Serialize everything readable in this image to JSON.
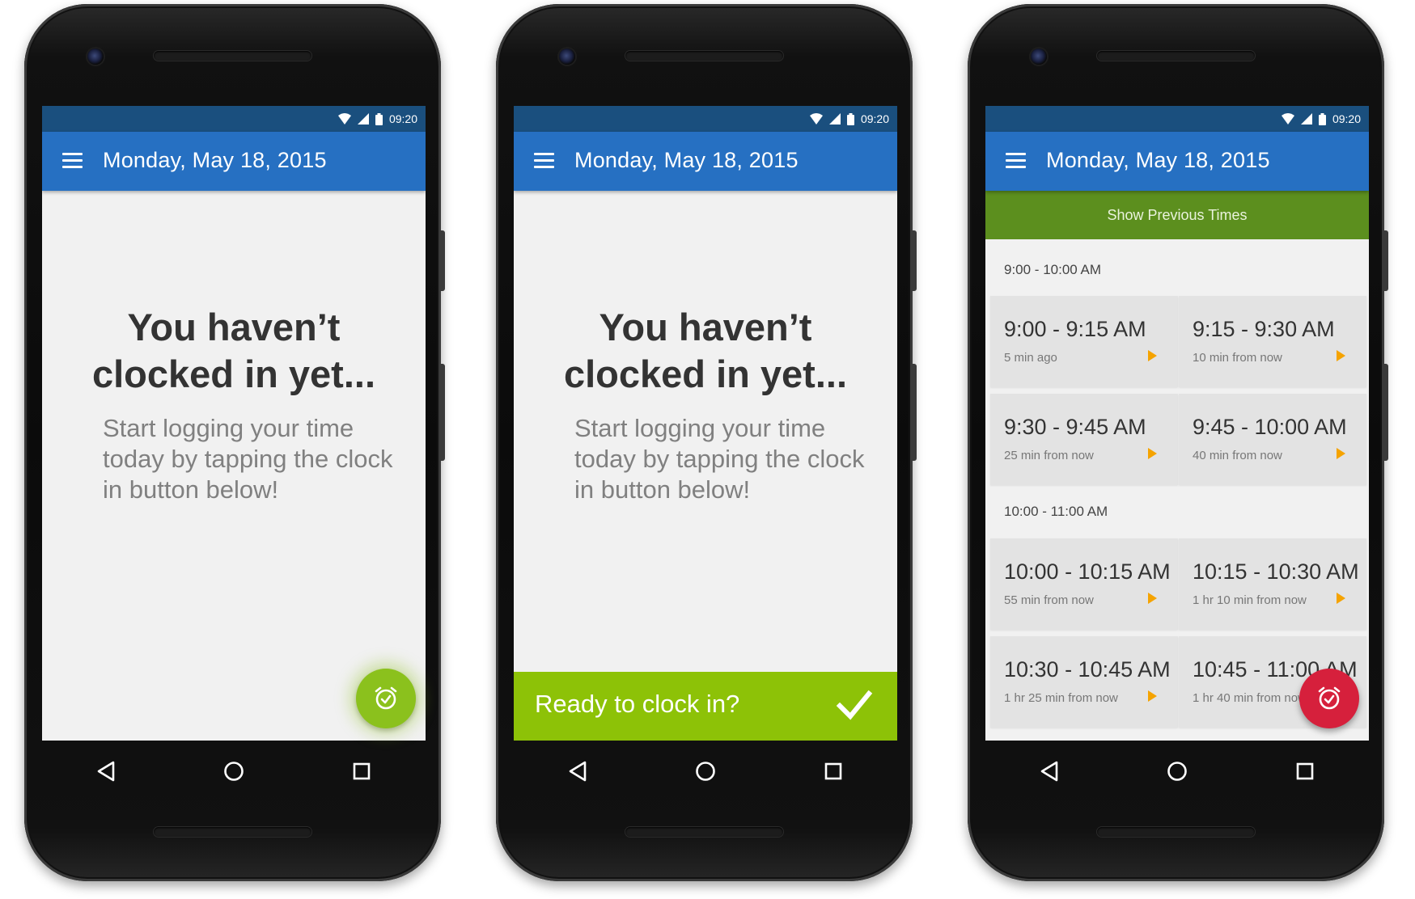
{
  "colors": {
    "status_bar": "#1a4f7e",
    "app_bar": "#2670c2",
    "accent_green": "#8bc11d",
    "confirm_green": "#8dc207",
    "previous_bar": "#5c8f1e",
    "fab_red": "#d6203c",
    "arrow_orange": "#f5a300"
  },
  "phones": [
    {
      "status": {
        "time": "09:20",
        "icons": [
          "wifi-icon",
          "signal-icon",
          "battery-icon"
        ]
      },
      "appbar": {
        "title": "Monday, May 18, 2015",
        "menu_icon": "menu-icon"
      },
      "empty": {
        "title_line1": "You haven’t",
        "title_line2": "clocked in yet...",
        "subtitle": "Start logging your time today by tapping the clock in button below!"
      },
      "fab": {
        "icon": "alarm-check-icon"
      }
    },
    {
      "status": {
        "time": "09:20",
        "icons": [
          "wifi-icon",
          "signal-icon",
          "battery-icon"
        ]
      },
      "appbar": {
        "title": "Monday, May 18, 2015",
        "menu_icon": "menu-icon"
      },
      "empty": {
        "title_line1": "You haven’t",
        "title_line2": "clocked in yet...",
        "subtitle": "Start logging your time today by tapping the clock in button below!"
      },
      "confirm": {
        "label": "Ready to clock in?",
        "icon": "check-icon"
      }
    },
    {
      "status": {
        "time": "09:20",
        "icons": [
          "wifi-icon",
          "signal-icon",
          "battery-icon"
        ]
      },
      "appbar": {
        "title": "Monday, May 18, 2015",
        "menu_icon": "menu-icon"
      },
      "previous": {
        "label": "Show Previous Times"
      },
      "groups": [
        {
          "label": "9:00 - 10:00 AM",
          "slots": [
            {
              "time": "9:00 - 9:15 AM",
              "relative": "5 min ago"
            },
            {
              "time": "9:15 - 9:30 AM",
              "relative": "10 min from now"
            },
            {
              "time": "9:30 - 9:45 AM",
              "relative": "25 min from now"
            },
            {
              "time": "9:45 - 10:00 AM",
              "relative": "40 min from now"
            }
          ]
        },
        {
          "label": "10:00 - 11:00 AM",
          "slots": [
            {
              "time": "10:00 - 10:15 AM",
              "relative": "55 min from now"
            },
            {
              "time": "10:15 - 10:30 AM",
              "relative": "1 hr 10 min from now"
            },
            {
              "time": "10:30 - 10:45 AM",
              "relative": "1 hr 25 min from now"
            },
            {
              "time": "10:45 - 11:00 AM",
              "relative": "1 hr 40 min from now"
            }
          ]
        }
      ],
      "fab": {
        "icon": "alarm-check-icon"
      }
    }
  ],
  "navbar": {
    "icons": [
      "back-icon",
      "home-icon",
      "recents-icon"
    ]
  }
}
